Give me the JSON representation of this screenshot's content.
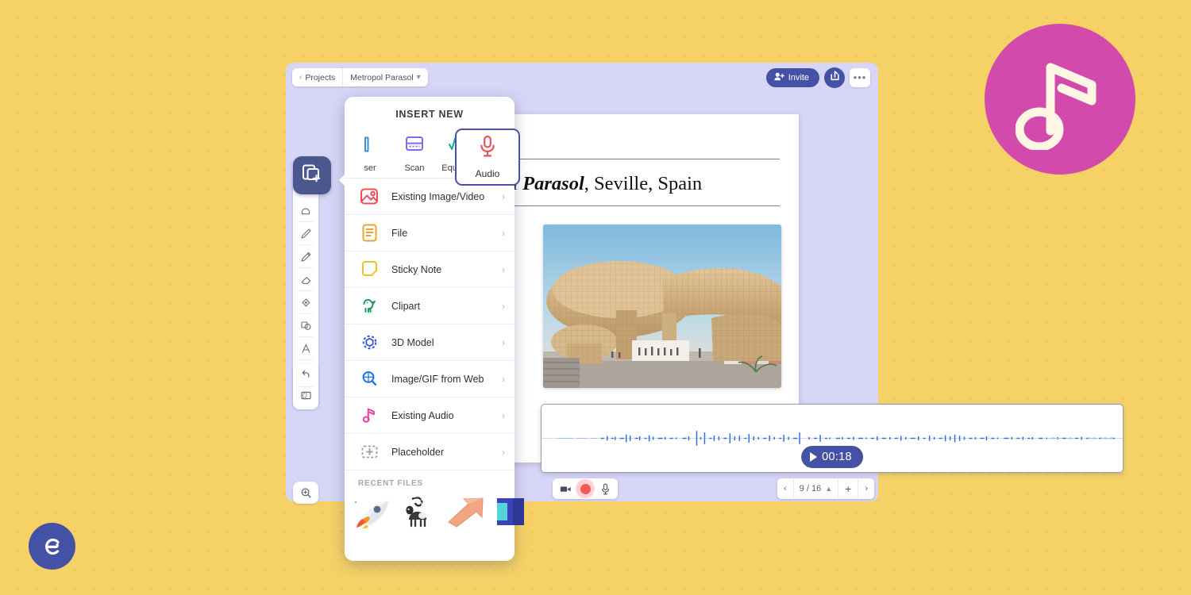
{
  "brand": {
    "logo_name": "explain-everything-logo",
    "accent_indigo": "#4452a6",
    "badge_magenta": "#d24bac",
    "background_yellow": "#f6d266",
    "app_surface_lavender": "#d7d6f6"
  },
  "decor": {
    "music_badge_icon": "music-note-icon"
  },
  "topbar": {
    "back_label": "Projects",
    "back_icon": "chevron-left-icon",
    "project_name": "Metropol Parasol",
    "project_chevron_icon": "chevron-down-icon",
    "invite_label": "Invite",
    "invite_icon": "person-add-icon",
    "share_icon": "share-icon",
    "more_icon": "more-horizontal-icon"
  },
  "toolbar": {
    "active_tool": "insert-new",
    "active_tool_icon": "add-slide-icon",
    "tools": [
      {
        "name": "hand-tool",
        "icon": "hand-icon"
      },
      {
        "name": "pen-tool",
        "icon": "pen-icon"
      },
      {
        "name": "marker-tool",
        "icon": "marker-icon"
      },
      {
        "name": "eraser-tool",
        "icon": "eraser-icon"
      },
      {
        "name": "fill-tool",
        "icon": "paint-bucket-icon"
      },
      {
        "name": "shape-tool",
        "icon": "shapes-icon"
      },
      {
        "name": "text-tool",
        "icon": "text-a-icon"
      },
      {
        "name": "select-tool",
        "icon": "marquee-select-icon"
      },
      {
        "name": "laser-tool",
        "icon": "laser-pointer-icon"
      }
    ],
    "undo": {
      "name": "undo-tool",
      "icon": "undo-arrow-icon"
    },
    "frame": {
      "name": "frame-tool",
      "icon": "frame-icon"
    },
    "zoom": {
      "name": "zoom-tool",
      "icon": "magnifier-plus-icon"
    }
  },
  "document": {
    "title_bold": "ol Parasol",
    "title_rest": ", Seville, Spain",
    "photo_name": "metropol-parasol-photo",
    "photo_alt": "Metropol Parasol wooden structure, Seville"
  },
  "audio": {
    "panel_name": "audio-waveform-panel",
    "play_icon": "play-triangle-icon",
    "duration": "00:18",
    "waveform_color": "#2f6fe0"
  },
  "record_bar": {
    "camera_icon": "video-camera-icon",
    "record_icon": "record-dot-icon",
    "mic_icon": "microphone-icon"
  },
  "page_nav": {
    "prev_icon": "chevron-left-icon",
    "indicator": "9 / 16",
    "expand_icon": "chevron-up-icon",
    "add_icon": "plus-icon",
    "next_icon": "chevron-right-icon"
  },
  "insert_popover": {
    "title": "INSERT NEW",
    "quick_items": [
      {
        "label": "ser",
        "icon": "laser-icon",
        "color": "#3d8ecc"
      },
      {
        "label": "Scan",
        "icon": "scan-icon",
        "color": "#7c6cf0"
      },
      {
        "label": "Equation",
        "icon": "equation-icon",
        "color": "#12a79d"
      }
    ],
    "highlighted_item": {
      "label": "Audio",
      "icon": "microphone-icon",
      "color": "#e8545a"
    },
    "menu_items": [
      {
        "label": "Existing Image/Video",
        "icon": "image-icon",
        "color": "#ef4e55"
      },
      {
        "label": "File",
        "icon": "file-lines-icon",
        "color": "#f0a030"
      },
      {
        "label": "Sticky Note",
        "icon": "sticky-note-icon",
        "color": "#f0c02f"
      },
      {
        "label": "Clipart",
        "icon": "clipart-bird-icon",
        "color": "#1e9c5a"
      },
      {
        "label": "3D Model",
        "icon": "cube-3d-icon",
        "color": "#3b4fd0"
      },
      {
        "label": "Image/GIF from Web",
        "icon": "web-search-icon",
        "color": "#1a74e8"
      },
      {
        "label": "Existing Audio",
        "icon": "music-note-icon",
        "color": "#ec3fa0"
      },
      {
        "label": "Placeholder",
        "icon": "placeholder-plus-icon",
        "color": "#9a9aab"
      }
    ],
    "chevron_icon": "chevron-right-icon",
    "recent_header": "RECENT FILES",
    "recent_files": [
      {
        "name": "rocket-thumbnail"
      },
      {
        "name": "lemur-thumbnail"
      },
      {
        "name": "arrow-thumbnail"
      },
      {
        "name": "blue-shape-thumbnail"
      }
    ]
  }
}
